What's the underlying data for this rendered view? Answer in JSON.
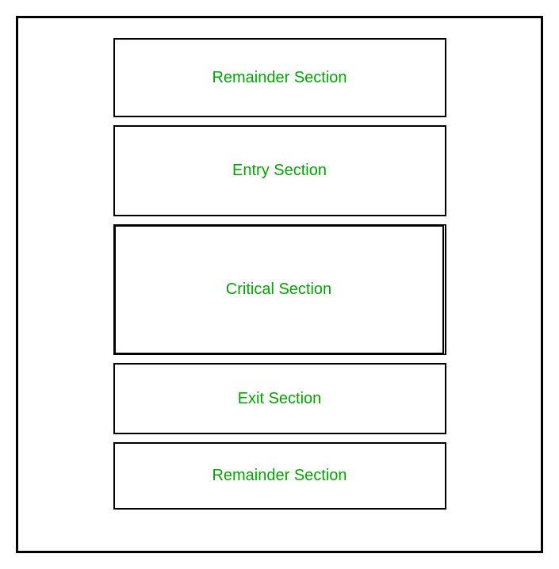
{
  "sections": {
    "remainder_top": "Remainder Section",
    "entry": "Entry Section",
    "critical": "Critical Section",
    "exit": "Exit Section",
    "remainder_bottom": "Remainder Section"
  }
}
